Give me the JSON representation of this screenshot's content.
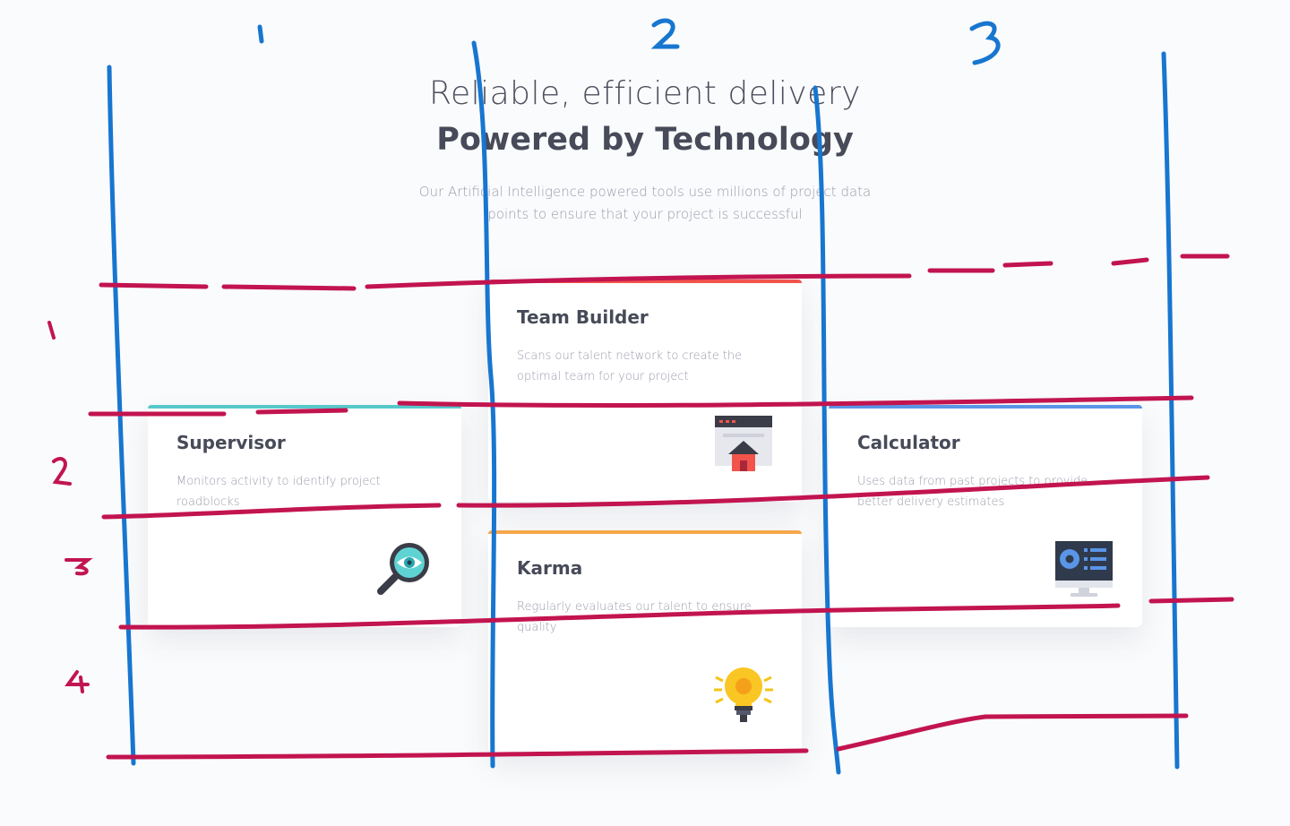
{
  "header": {
    "eyebrow": "Reliable, efficient delivery",
    "title": "Powered by Technology",
    "subtitle": "Our Artificial Intelligence powered tools use millions of project data points to ensure that your project is successful"
  },
  "cards": [
    {
      "title": "Team Builder",
      "description": "Scans our talent network to create the optimal team for your project",
      "accent": "#f2544c",
      "icon": "browser-house-icon"
    },
    {
      "title": "Supervisor",
      "description": "Monitors activity to identify project roadblocks",
      "accent": "#56c8cc",
      "icon": "magnifier-eye-icon"
    },
    {
      "title": "Calculator",
      "description": "Uses data from past projects to provide better delivery estimates",
      "accent": "#5a95e8",
      "icon": "monitor-dashboard-icon"
    },
    {
      "title": "Karma",
      "description": "Regularly evaluates our talent to ensure quality",
      "accent": "#f5a74a",
      "icon": "lightbulb-icon"
    }
  ],
  "annotations": {
    "columns": [
      "1",
      "2",
      "3"
    ],
    "rows": [
      "1",
      "2",
      "3",
      "4"
    ],
    "column_color": "#1776d0",
    "row_color": "#c2144f"
  }
}
